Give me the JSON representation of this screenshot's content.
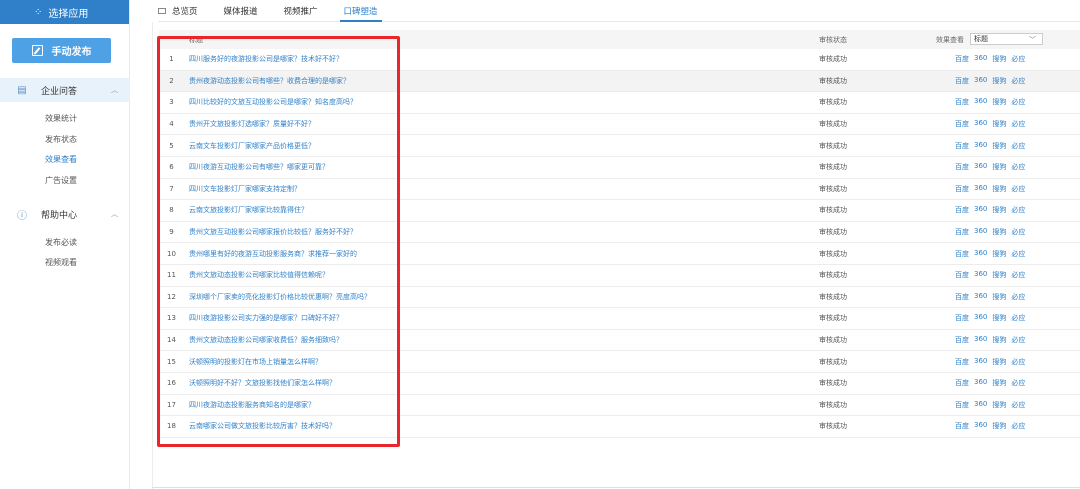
{
  "sidebar": {
    "app_switch": "选择应用",
    "publish": "手动发布",
    "sections": [
      {
        "label": "企业问答",
        "items": [
          "效果统计",
          "发布状态",
          "效果查看",
          "广告设置"
        ],
        "active_item": 2
      },
      {
        "label": "帮助中心",
        "items": [
          "发布必读",
          "视频观看"
        ]
      }
    ]
  },
  "tabs": [
    "总览页",
    "媒体报道",
    "视频推广",
    "口碑塑造"
  ],
  "active_tab": 3,
  "table": {
    "header": {
      "title": "标题",
      "status": "审核状态",
      "effect": "效果查看",
      "select_value": "标题"
    },
    "rows": [
      {
        "num": "1",
        "title": "四川服务好的夜游投影公司是哪家？技术好不好？",
        "status": "审核成功"
      },
      {
        "num": "2",
        "title": "贵州夜游动态投影公司有哪些？收费合理的是哪家？",
        "status": "审核成功"
      },
      {
        "num": "3",
        "title": "四川比较好的文旅互动投影公司是哪家？知名度高吗？",
        "status": "审核成功"
      },
      {
        "num": "4",
        "title": "贵州开文旅投影灯选哪家？质量好不好？",
        "status": "审核成功"
      },
      {
        "num": "5",
        "title": "云南文车投影灯厂家哪家产品价格更低？",
        "status": "审核成功"
      },
      {
        "num": "6",
        "title": "四川夜游互动投影公司有哪些？哪家更可靠？",
        "status": "审核成功"
      },
      {
        "num": "7",
        "title": "四川文车投影灯厂家哪家支持定制？",
        "status": "审核成功"
      },
      {
        "num": "8",
        "title": "云南文旅投影灯厂家哪家比较靠得住？",
        "status": "审核成功"
      },
      {
        "num": "9",
        "title": "贵州文旅互动投影公司哪家报价比较低？服务好不好？",
        "status": "审核成功"
      },
      {
        "num": "10",
        "title": "贵州哪里有好的夜游互动投影服务商？求推荐一家好的",
        "status": "审核成功"
      },
      {
        "num": "11",
        "title": "贵州文旅动态投影公司哪家比较值得信赖呢？",
        "status": "审核成功"
      },
      {
        "num": "12",
        "title": "深圳哪个厂家卖的亮化投影灯价格比较优惠啊？亮度高吗？",
        "status": "审核成功"
      },
      {
        "num": "13",
        "title": "四川夜游投影公司实力强的是哪家？口碑好不好？",
        "status": "审核成功"
      },
      {
        "num": "14",
        "title": "贵州文旅动态投影公司哪家收费低？服务细致吗？",
        "status": "审核成功"
      },
      {
        "num": "15",
        "title": "沃顿照明的投影灯在市场上销量怎么样啊？",
        "status": "审核成功"
      },
      {
        "num": "16",
        "title": "沃顿照明好不好？文旅投影找他们家怎么样啊？",
        "status": "审核成功"
      },
      {
        "num": "17",
        "title": "四川夜游动态投影服务商知名的是哪家？",
        "status": "审核成功"
      },
      {
        "num": "18",
        "title": "云南哪家公司做文旅投影比较厉害？技术好吗？",
        "status": "审核成功"
      }
    ],
    "links": [
      "百度",
      "360",
      "搜狗",
      "必应"
    ]
  },
  "colors": {
    "accent": "#2f80c8",
    "highlight_box": "#e8262b",
    "publish_btn": "#4ea1e4"
  }
}
